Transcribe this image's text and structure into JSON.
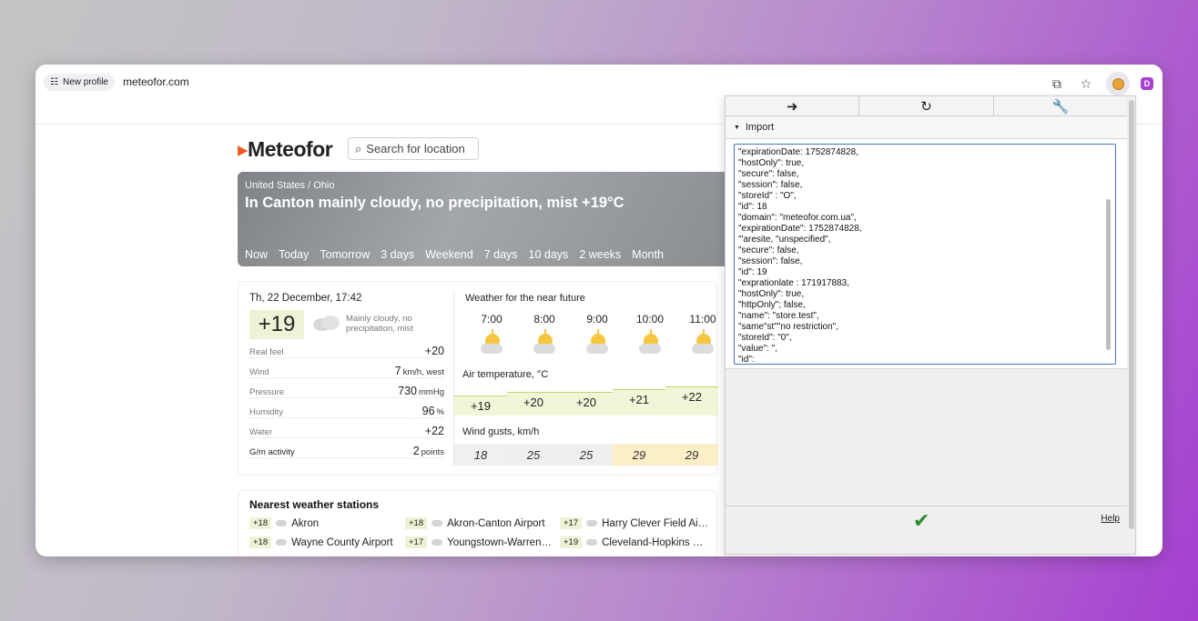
{
  "browser": {
    "profile_label": "New profile",
    "url": "meteofor.com"
  },
  "site": {
    "logo_text": "Meteofor",
    "search_placeholder": "Search for location",
    "location": "United States / Ohio",
    "headline": "In Canton mainly cloudy, no precipitation, mist +19°C",
    "tabs": [
      "Now",
      "Today",
      "Tomorrow",
      "3 days",
      "Weekend",
      "7 days",
      "10 days",
      "2 weeks",
      "Month"
    ],
    "now": {
      "datetime": "Th, 22 December, 17:42",
      "temp": "+19",
      "desc": "Mainly cloudy, no precipitation, mist",
      "params": [
        {
          "name": "Real feel",
          "value": "+20",
          "unit": ""
        },
        {
          "name": "Wind",
          "value": "7",
          "unit": "km/h, west"
        },
        {
          "name": "Pressure",
          "value": "730",
          "unit": "mmHg"
        },
        {
          "name": "Humidity",
          "value": "96",
          "unit": "%"
        },
        {
          "name": "Water",
          "value": "+22",
          "unit": ""
        },
        {
          "name": "G/m activity",
          "value": "2",
          "unit": "points"
        }
      ]
    },
    "forecast": {
      "title": "Weather for the near future",
      "hours": [
        "7:00",
        "8:00",
        "9:00",
        "10:00",
        "11:00"
      ],
      "air_label": "Air temperature, °C",
      "temps": [
        "+19",
        "+20",
        "+20",
        "+21",
        "+22"
      ],
      "gust_label": "Wind gusts, km/h",
      "gusts": [
        "18",
        "25",
        "25",
        "29",
        "29"
      ]
    },
    "stations": {
      "title": "Nearest weather stations",
      "items": [
        {
          "temp": "+18",
          "name": "Akron"
        },
        {
          "temp": "+18",
          "name": "Akron-Canton Airport"
        },
        {
          "temp": "+17",
          "name": "Harry Clever Field Ai…"
        },
        {
          "temp": "+18",
          "name": "Wayne County Airport"
        },
        {
          "temp": "+17",
          "name": "Youngstown-Warren…"
        },
        {
          "temp": "+19",
          "name": "Cleveland-Hopkins …"
        }
      ]
    }
  },
  "extension": {
    "section_label": "Import",
    "import_text": "\"expirationDate: 1752874828,\n\"hostOnly\": true,\n\"secure\": false,\n\"session\": false,\n\"storeId\" : \"O\",\n\"id\": 18\n\"domain\": \"meteofor.com.ua\",\n\"expirationDate\": 1752874828,\n\"'aresite, \"unspecified\",\n\"secure\": false,\n\"session\": false,\n\"id\": 19\n\"exprationlate : 171917883,\n\"hostOnly\": true,\n\"httpOnly\"; false,\n\"name\": \"store.test\",\n\"same\"st\"\"no restriction\",\n\"storeId\": \"0\",\n\"value\": \",\n\"id\":",
    "help_label": "Help"
  }
}
